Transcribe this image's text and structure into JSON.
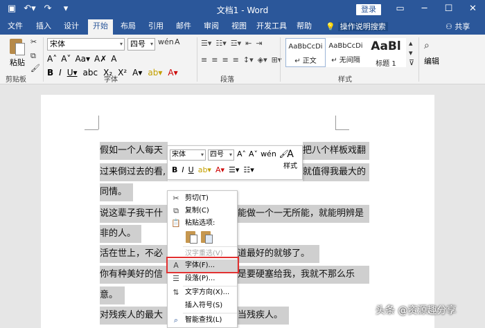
{
  "titlebar": {
    "doc_title": "文档1 - Word",
    "login": "登录"
  },
  "tabs": [
    "文件",
    "插入",
    "设计",
    "开始",
    "布局",
    "引用",
    "邮件",
    "审阅",
    "视图",
    "开发工具",
    "帮助"
  ],
  "active_tab": "开始",
  "tell_me": "操作说明搜索",
  "share": "共享",
  "ribbon": {
    "paste_label": "粘贴",
    "font_name": "宋体",
    "font_size": "四号",
    "groups": {
      "clipboard": "剪贴板",
      "font": "字体",
      "paragraph": "段落",
      "styles": "样式"
    },
    "styles": [
      {
        "sample": "AaBbCcDi",
        "name": "↵ 正文"
      },
      {
        "sample": "AaBbCcDi",
        "name": "↵ 无间隔"
      },
      {
        "sample": "AaBl",
        "name": "标题 1"
      }
    ],
    "edit_label": "编辑"
  },
  "document": {
    "lines": [
      {
        "left": "假如一个人每天",
        "right": "把八个样板戏翻"
      },
      {
        "left": "过来倒过去的看,",
        "right": "就值得我最大的"
      },
      {
        "left": "同情。",
        "right": ""
      },
      {
        "left": "说这辈子我干什",
        "right": "能做一个一无所能，就能明辨是"
      },
      {
        "left": "非的人。",
        "right": ""
      },
      {
        "left": "活在世上，不必",
        "right": "道最好的就够了。"
      },
      {
        "left": "你有种美好的信",
        "right": "是要硬塞给我，我就不那么乐"
      },
      {
        "left": "意。",
        "right": ""
      },
      {
        "left": "对残疾人的最大",
        "right": "当残疾人。"
      }
    ]
  },
  "mini_toolbar": {
    "font": "宋体",
    "size": "四号",
    "styles_label": "样式"
  },
  "context_menu": {
    "cut": "剪切(T)",
    "copy": "复制(C)",
    "paste_options": "粘贴选项:",
    "hanzi": "汉字重选(V)",
    "font": "字体(F)...",
    "paragraph": "段落(P)...",
    "text_direction": "文字方向(X)...",
    "insert_symbol": "插入符号(S)",
    "smart_lookup": "智能查找(L)"
  },
  "watermark": "头条 @资源趣分享",
  "colors": {
    "brand": "#2b579a",
    "highlight_box": "#e23030"
  }
}
